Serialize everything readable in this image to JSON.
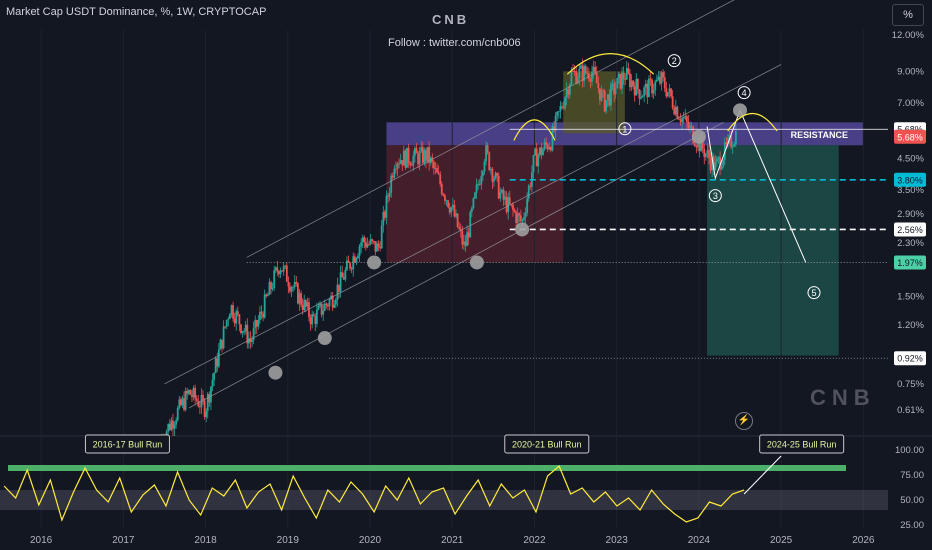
{
  "header": {
    "symbol_line": "Market Cap USDT Dominance, %, 1W, CRYPTOCAP",
    "brand": "CNB",
    "follow": "Follow : twitter.com/cnb006",
    "scale_button": "%"
  },
  "watermark": "CNB",
  "colors": {
    "background": "#131722",
    "up": "#26a69a",
    "down": "#ef5350",
    "rsi_line": "#ffeb3b",
    "resistance_zone": "#5b4da8",
    "bull_zone": "#5a5a28",
    "target_zone": "#1f4f4a",
    "accumulation_zone": "#5b2230"
  },
  "chart_data": [
    {
      "type": "candlestick",
      "title": "Market Cap USDT Dominance, %, 1W, CRYPTOCAP",
      "y_scale": "log",
      "ylim": [
        0.52,
        12.5
      ],
      "x_range": [
        2015.5,
        2026.3
      ],
      "y_ticks": [
        "12.00%",
        "9.00%",
        "7.00%",
        "5.68%",
        "4.50%",
        "3.50%",
        "2.90%",
        "2.30%",
        "1.97%",
        "1.50%",
        "1.20%",
        "0.92%",
        "0.75%",
        "0.61%"
      ],
      "x_ticks": [
        "2016",
        "2017",
        "2018",
        "2019",
        "2020",
        "2021",
        "2022",
        "2023",
        "2024",
        "2025",
        "2026"
      ],
      "price_path": [
        [
          2017.45,
          0.48
        ],
        [
          2017.8,
          0.7
        ],
        [
          2018.0,
          0.62
        ],
        [
          2018.3,
          1.4
        ],
        [
          2018.55,
          1.05
        ],
        [
          2018.9,
          1.95
        ],
        [
          2019.3,
          1.25
        ],
        [
          2019.55,
          1.5
        ],
        [
          2019.9,
          2.35
        ],
        [
          2020.1,
          2.2
        ],
        [
          2020.3,
          4.5
        ],
        [
          2020.7,
          4.6
        ],
        [
          2021.0,
          3.0
        ],
        [
          2021.15,
          2.2
        ],
        [
          2021.4,
          4.8
        ],
        [
          2021.6,
          3.3
        ],
        [
          2021.85,
          2.7
        ],
        [
          2022.0,
          4.5
        ],
        [
          2022.2,
          5.2
        ],
        [
          2022.45,
          8.8
        ],
        [
          2022.7,
          9.0
        ],
        [
          2022.85,
          7.0
        ],
        [
          2023.1,
          8.8
        ],
        [
          2023.3,
          7.6
        ],
        [
          2023.55,
          8.4
        ],
        [
          2023.75,
          6.5
        ],
        [
          2024.0,
          5.1
        ],
        [
          2024.2,
          4.2
        ],
        [
          2024.45,
          5.5
        ]
      ],
      "levels": [
        {
          "label": "5.68%",
          "value": 5.68,
          "style": "solid",
          "color": "#ffffff"
        },
        {
          "label": "3.80%",
          "value": 3.8,
          "style": "dashed",
          "color": "#00bcd4"
        },
        {
          "label": "2.56%",
          "value": 2.56,
          "style": "dashed",
          "color": "#ffffff"
        },
        {
          "label": "1.97%",
          "value": 1.97,
          "style": "dotted",
          "color": "#9aa0a6"
        },
        {
          "label": "0.92%",
          "value": 0.92,
          "style": "dotted",
          "color": "#9aa0a6"
        }
      ],
      "price_tags": [
        {
          "label": "5.68%",
          "value": 5.68,
          "bg": "#ffffff",
          "fg": "#131722"
        },
        {
          "label": "5.68%",
          "value": 5.35,
          "bg": "#ef5350",
          "fg": "#ffffff"
        },
        {
          "label": "3.80%",
          "value": 3.8,
          "bg": "#00bcd4",
          "fg": "#131722"
        },
        {
          "label": "2.56%",
          "value": 2.56,
          "bg": "#ffffff",
          "fg": "#131722"
        },
        {
          "label": "1.97%",
          "value": 1.97,
          "bg": "#4dd0a6",
          "fg": "#131722"
        },
        {
          "label": "0.92%",
          "value": 0.92,
          "bg": "#ffffff",
          "fg": "#131722"
        }
      ],
      "zones": [
        {
          "name": "resistance",
          "x": [
            2020.2,
            2026.0
          ],
          "y": [
            5.0,
            6.0
          ],
          "label": "RESISTANCE"
        },
        {
          "name": "accumulation",
          "x": [
            2020.2,
            2022.35
          ],
          "y": [
            1.97,
            5.0
          ]
        },
        {
          "name": "distribution",
          "x": [
            2022.35,
            2023.1
          ],
          "y": [
            5.5,
            9.0
          ]
        },
        {
          "name": "target",
          "x": [
            2024.1,
            2025.7
          ],
          "y": [
            0.94,
            5.0
          ]
        }
      ],
      "channel_lines": [
        [
          [
            2018.5,
            2.05
          ],
          [
            2025.5,
            23.0
          ]
        ],
        [
          [
            2017.8,
            0.62
          ],
          [
            2024.3,
            6.0
          ]
        ],
        [
          [
            2017.5,
            0.75
          ],
          [
            2025.0,
            9.5
          ]
        ]
      ],
      "touch_points": [
        [
          2018.85,
          0.82
        ],
        [
          2019.45,
          1.08
        ],
        [
          2020.05,
          1.97
        ],
        [
          2021.3,
          1.97
        ],
        [
          2021.85,
          2.56
        ],
        [
          2024.0,
          5.35
        ],
        [
          2024.5,
          6.6
        ]
      ],
      "wave_labels": [
        {
          "label": "1",
          "x": 2023.1,
          "y": 5.7
        },
        {
          "label": "2",
          "x": 2023.7,
          "y": 9.8
        },
        {
          "label": "3",
          "x": 2024.2,
          "y": 3.35
        },
        {
          "label": "4",
          "x": 2024.55,
          "y": 7.6
        },
        {
          "label": "5",
          "x": 2025.4,
          "y": 1.55
        }
      ],
      "projection_path": [
        [
          2024.1,
          5.8
        ],
        [
          2024.2,
          3.85
        ],
        [
          2024.5,
          6.6
        ],
        [
          2025.3,
          1.97
        ]
      ]
    },
    {
      "type": "line",
      "title": "",
      "ylim": [
        22,
        108
      ],
      "y_ticks": [
        "100.00",
        "75.00",
        "50.00",
        "25.00"
      ],
      "series": [
        {
          "values": [
            64,
            52,
            80,
            45,
            70,
            30,
            58,
            82,
            60,
            48,
            72,
            38,
            55,
            65,
            44,
            78,
            50,
            35,
            62,
            54,
            70,
            42,
            58,
            66,
            40,
            74,
            52,
            32,
            60,
            48,
            68,
            56,
            38,
            64,
            50,
            72,
            46,
            58,
            62,
            36,
            54,
            70,
            44,
            66,
            52,
            60,
            38,
            74,
            84,
            56,
            62,
            48,
            58,
            44,
            52,
            40,
            60,
            46,
            36,
            28,
            32,
            48,
            44,
            56,
            60
          ]
        }
      ],
      "band": [
        40,
        60
      ],
      "overbought": 82,
      "annotations": [
        {
          "label": "2016-17 Bull Run",
          "x": 2017.05
        },
        {
          "label": "2020-21 Bull Run",
          "x": 2022.15
        },
        {
          "label": "2024-25 Bull Run",
          "x": 2025.25
        }
      ]
    }
  ]
}
